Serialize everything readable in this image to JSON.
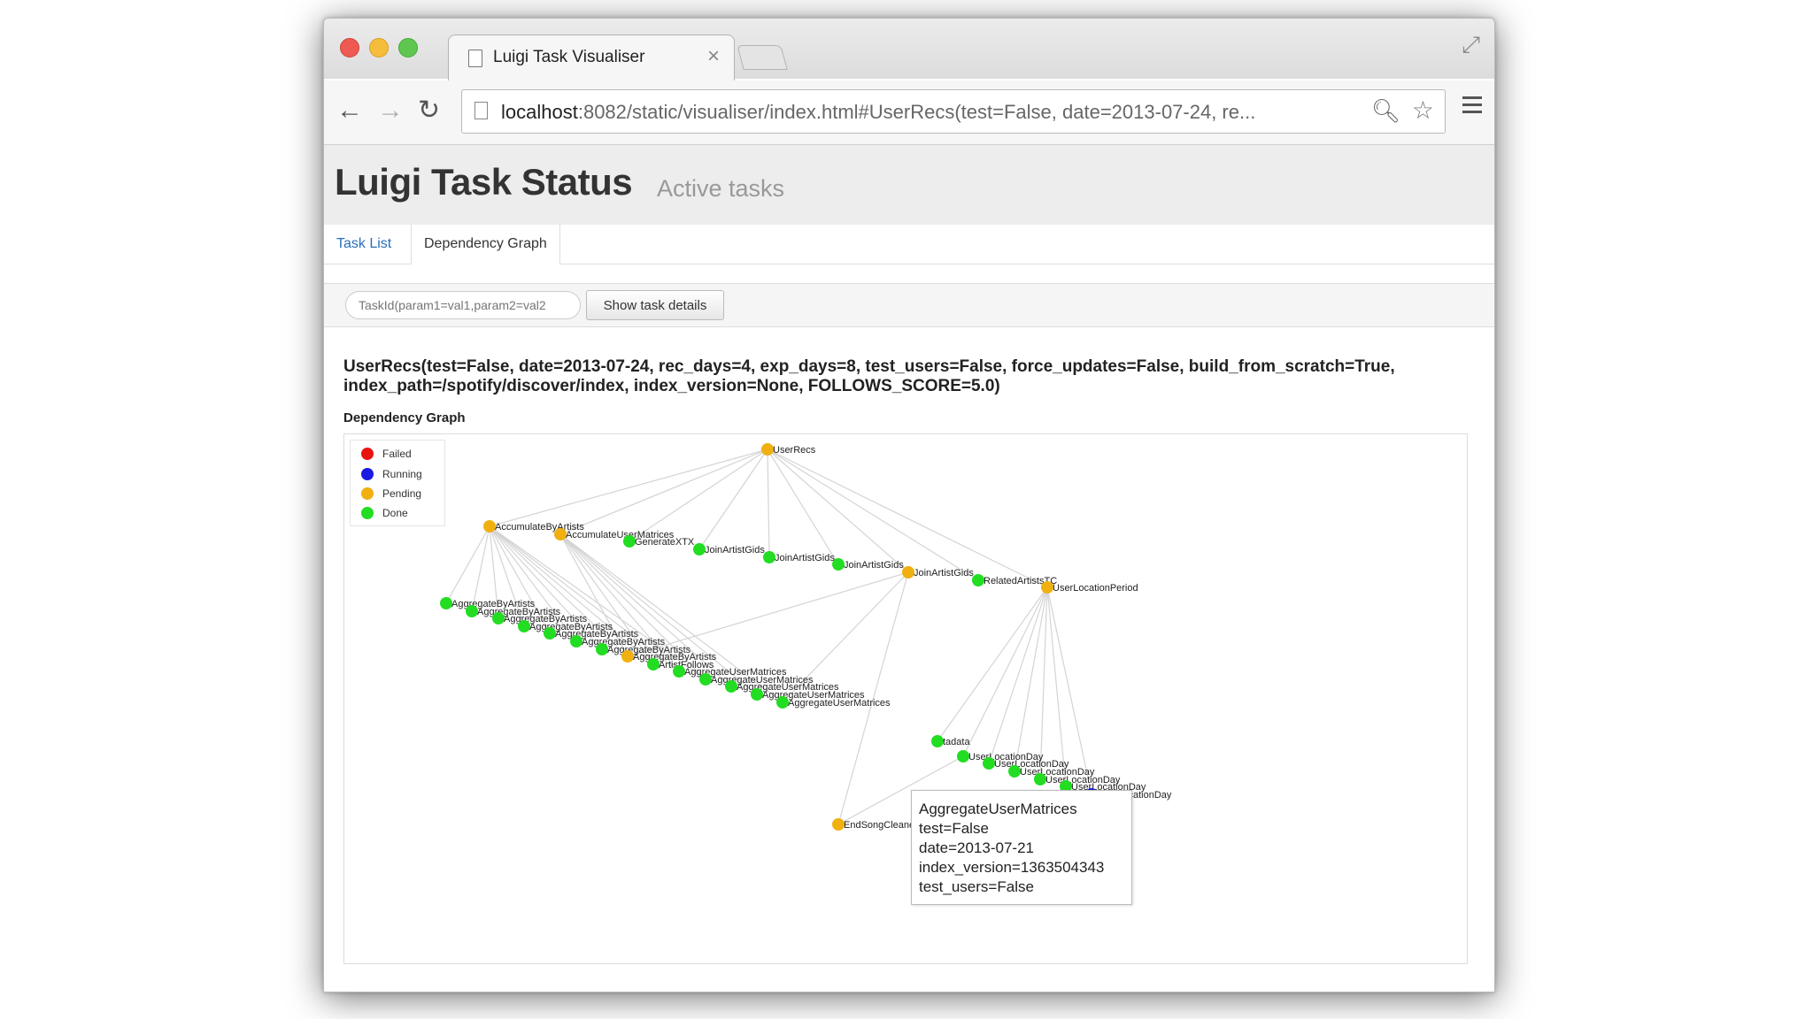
{
  "browser": {
    "tab_title": "Luigi Task Visualiser",
    "tab_close": "×",
    "url_host": "localhost",
    "url_rest": ":8082/static/visualiser/index.html#UserRecs(test=False, date=2013-07-24, re...",
    "icons": [
      "document-icon",
      "back-icon",
      "forward-icon",
      "reload-icon",
      "search-icon",
      "star-icon",
      "menu-icon",
      "expand-icon"
    ]
  },
  "page": {
    "title": "Luigi Task Status",
    "subtitle": "Active tasks",
    "tabs": [
      {
        "label": "Task List"
      },
      {
        "label": "Dependency Graph"
      }
    ],
    "search_placeholder": "TaskId(param1=val1,param2=val2",
    "show_details_label": "Show task details",
    "task_heading": "UserRecs(test=False, date=2013-07-24, rec_days=4, exp_days=8, test_users=False, force_updates=False, build_from_scratch=True, index_path=/spotify/discover/index, index_version=None, FOLLOWS_SCORE=5.0)",
    "graph_label": "Dependency Graph"
  },
  "legend": [
    {
      "label": "Failed",
      "color": "#e8140f"
    },
    {
      "label": "Running",
      "color": "#1a1ae0"
    },
    {
      "label": "Pending",
      "color": "#f0b010"
    },
    {
      "label": "Done",
      "color": "#22dd22"
    }
  ],
  "colors": {
    "Failed": "#e8140f",
    "Running": "#1a1ae0",
    "Pending": "#f0b010",
    "Done": "#22dd22",
    "edge": "#d4d4d4"
  },
  "graph": {
    "nodes": [
      {
        "id": "root",
        "label": "UserRecs",
        "status": "Pending"
      },
      {
        "id": "aba",
        "label": "AccumulateByArtists",
        "status": "Pending"
      },
      {
        "id": "aum",
        "label": "AccumulateUserMatrices",
        "status": "Pending"
      },
      {
        "id": "gxtx",
        "label": "GenerateXTX",
        "status": "Done"
      },
      {
        "id": "jag1",
        "label": "JoinArtistGids",
        "status": "Done"
      },
      {
        "id": "jag2",
        "label": "JoinArtistGids",
        "status": "Done"
      },
      {
        "id": "jag3",
        "label": "JoinArtistGids",
        "status": "Done"
      },
      {
        "id": "jag4",
        "label": "JoinArtistGids",
        "status": "Pending"
      },
      {
        "id": "ratc",
        "label": "RelatedArtistsTC",
        "status": "Done"
      },
      {
        "id": "ulp",
        "label": "UserLocationPeriod",
        "status": "Pending"
      },
      {
        "id": "agba1",
        "label": "AggregateByArtists",
        "status": "Done"
      },
      {
        "id": "agba2",
        "label": "AggregateByArtists",
        "status": "Done"
      },
      {
        "id": "agba3",
        "label": "AggregateByArtists",
        "status": "Done"
      },
      {
        "id": "agba4",
        "label": "AggregateByArtists",
        "status": "Done"
      },
      {
        "id": "agba5",
        "label": "AggregateByArtists",
        "status": "Done"
      },
      {
        "id": "agba6",
        "label": "AggregateByArtists",
        "status": "Done"
      },
      {
        "id": "agba7",
        "label": "AggregateByArtists",
        "status": "Done"
      },
      {
        "id": "agba8",
        "label": "AggregateByArtists",
        "status": "Pending"
      },
      {
        "id": "af",
        "label": "ArtistFollows",
        "status": "Done"
      },
      {
        "id": "agum1",
        "label": "AggregateUserMatrices",
        "status": "Done"
      },
      {
        "id": "agum2",
        "label": "AggregateUserMatrices",
        "status": "Done"
      },
      {
        "id": "agum3",
        "label": "AggregateUserMatrices",
        "status": "Done"
      },
      {
        "id": "agum4",
        "label": "AggregateUserMatrices",
        "status": "Done"
      },
      {
        "id": "agum5",
        "label": "AggregateUserMatrices",
        "status": "Done"
      },
      {
        "id": "meta",
        "label": "tadata",
        "status": "Done"
      },
      {
        "id": "uld1",
        "label": "UserLocationDay",
        "status": "Done"
      },
      {
        "id": "uld2",
        "label": "UserLocationDay",
        "status": "Done"
      },
      {
        "id": "uld3",
        "label": "UserLocationDay",
        "status": "Done"
      },
      {
        "id": "uld4",
        "label": "UserLocationDay",
        "status": "Done"
      },
      {
        "id": "uld5",
        "label": "UserLocationDay",
        "status": "Done"
      },
      {
        "id": "uld6",
        "label": "UserLocationDay",
        "status": "Running"
      },
      {
        "id": "esc1",
        "label": "EndSongCleaned",
        "status": "Pending"
      },
      {
        "id": "esc2",
        "label": "EndSongCleaned",
        "status": "Done"
      }
    ],
    "edges": [
      [
        "root",
        "aba"
      ],
      [
        "root",
        "aum"
      ],
      [
        "root",
        "gxtx"
      ],
      [
        "root",
        "jag1"
      ],
      [
        "root",
        "jag2"
      ],
      [
        "root",
        "jag3"
      ],
      [
        "root",
        "jag4"
      ],
      [
        "root",
        "ratc"
      ],
      [
        "root",
        "ulp"
      ],
      [
        "aba",
        "agba1"
      ],
      [
        "aba",
        "agba2"
      ],
      [
        "aba",
        "agba3"
      ],
      [
        "aba",
        "agba4"
      ],
      [
        "aba",
        "agba5"
      ],
      [
        "aba",
        "agba6"
      ],
      [
        "aba",
        "agba7"
      ],
      [
        "aba",
        "agba8"
      ],
      [
        "aba",
        "af"
      ],
      [
        "aba",
        "agum1"
      ],
      [
        "aba",
        "agum2"
      ],
      [
        "aum",
        "agum1"
      ],
      [
        "aum",
        "agum2"
      ],
      [
        "aum",
        "agum3"
      ],
      [
        "aum",
        "agum4"
      ],
      [
        "aum",
        "agum5"
      ],
      [
        "aum",
        "af"
      ],
      [
        "aum",
        "agba8"
      ],
      [
        "jag4",
        "agba8"
      ],
      [
        "jag4",
        "agum5"
      ],
      [
        "jag4",
        "esc1"
      ],
      [
        "ulp",
        "meta"
      ],
      [
        "ulp",
        "uld1"
      ],
      [
        "ulp",
        "uld2"
      ],
      [
        "ulp",
        "uld3"
      ],
      [
        "ulp",
        "uld4"
      ],
      [
        "ulp",
        "uld5"
      ],
      [
        "ulp",
        "uld6"
      ],
      [
        "uld6",
        "esc2"
      ],
      [
        "uld1",
        "esc1"
      ]
    ]
  },
  "tooltip": {
    "lines": [
      "AggregateUserMatrices",
      "test=False",
      "date=2013-07-21",
      "index_version=1363504343",
      "test_users=False"
    ]
  }
}
